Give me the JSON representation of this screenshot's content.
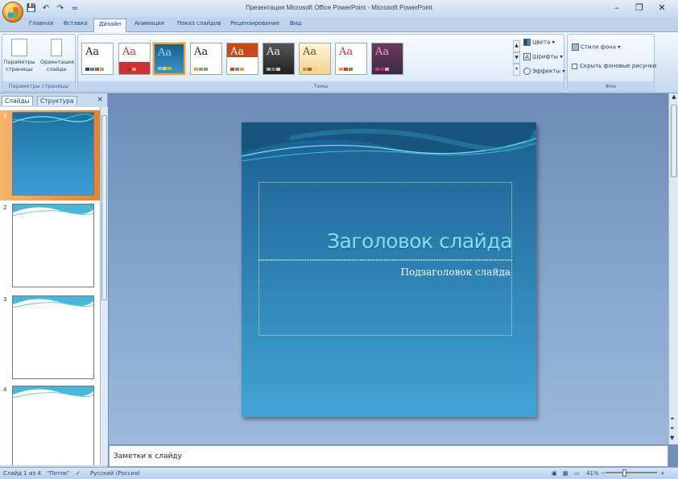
{
  "window": {
    "title": "Презентация Microsoft Office PowerPoint - Microsoft PowerPoint",
    "minimize": "–",
    "restore": "❐",
    "close": "✕"
  },
  "qat": {
    "save": "💾",
    "undo": "↶",
    "redo": "↷",
    "customize": "="
  },
  "tabs": [
    {
      "label": "Главная",
      "active": false
    },
    {
      "label": "Вставка",
      "active": false
    },
    {
      "label": "Дизайн",
      "active": true
    },
    {
      "label": "Анимация",
      "active": false
    },
    {
      "label": "Показ слайдов",
      "active": false
    },
    {
      "label": "Рецензирование",
      "active": false
    },
    {
      "label": "Вид",
      "active": false
    }
  ],
  "ribbon": {
    "page_setup": {
      "group_label": "Параметры страницы",
      "page_params_label": "Параметры страницы",
      "orientation_label": "Ориентация слайда"
    },
    "themes": {
      "group_label": "Темы",
      "tile_text": [
        "Aa",
        "Aa",
        "Aa",
        "Aa",
        "Aa",
        "Aa",
        "Aa",
        "Aa",
        "Aa"
      ],
      "selected_index": 2,
      "scroll_up": "▲",
      "scroll_down": "▼",
      "scroll_more": "▾",
      "colors_label": "Цвета",
      "fonts_label": "Шрифты",
      "effects_label": "Эффекты"
    },
    "background": {
      "group_label": "Фон",
      "styles_label": "Стили фона",
      "hide_label": "Скрыть фоновые рисунки"
    }
  },
  "panel": {
    "tab_slides": "Слайды",
    "tab_outline": "Структура",
    "close": "×",
    "slide_numbers": [
      "1",
      "2",
      "3",
      "4"
    ]
  },
  "slide": {
    "title": "Заголовок слайда",
    "subtitle": "Подзаголовок слайда"
  },
  "notes": {
    "text": "Заметки к слайду"
  },
  "status": {
    "slide_info": "Слайд 1 из 4",
    "theme": "\"Поток\"",
    "language": "Русский (Россия)",
    "zoom": "41%",
    "zoom_minus": "−",
    "zoom_plus": "+"
  },
  "colors": {
    "accent": "#e5822f",
    "ribbon_text": "#15428b",
    "title_color": "#7fe3f5"
  }
}
